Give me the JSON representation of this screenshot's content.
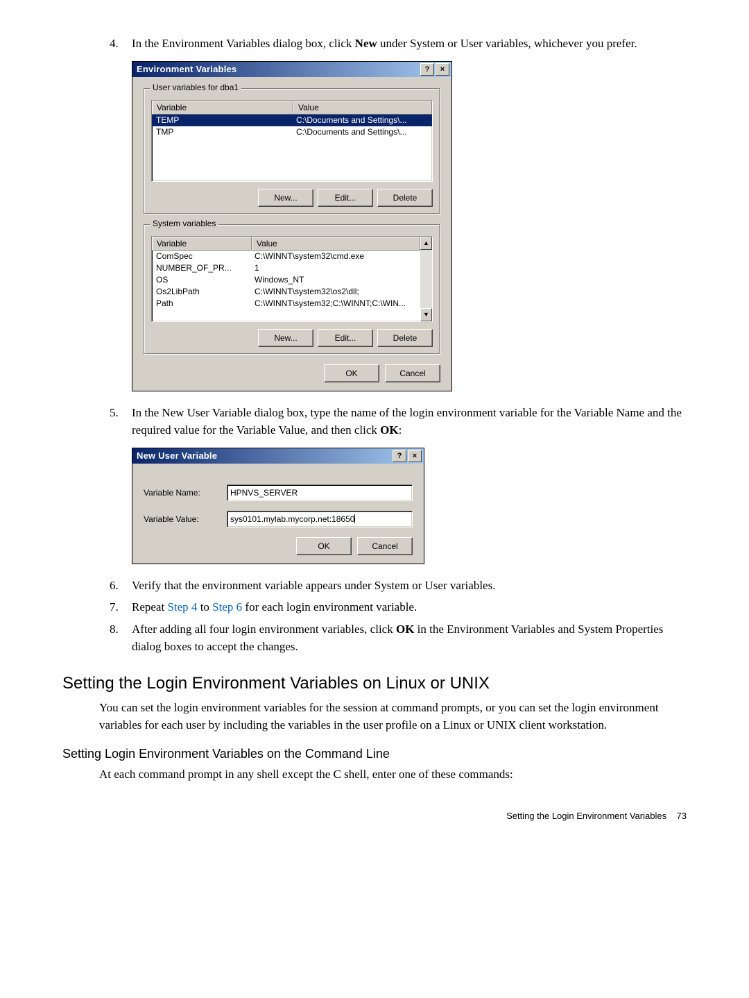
{
  "step4": {
    "num": "4.",
    "text_pre": "In the Environment Variables dialog box, click ",
    "bold": "New",
    "text_post": " under System or User variables, whichever you prefer."
  },
  "env_dialog": {
    "title": "Environment Variables",
    "help_btn": "?",
    "close_btn": "×",
    "user_legend": "User variables for dba1",
    "sys_legend": "System variables",
    "col_variable": "Variable",
    "col_value": "Value",
    "user_rows": [
      {
        "var": "TEMP",
        "val": "C:\\Documents and Settings\\..."
      },
      {
        "var": "TMP",
        "val": "C:\\Documents and Settings\\..."
      }
    ],
    "sys_rows": [
      {
        "var": "ComSpec",
        "val": "C:\\WINNT\\system32\\cmd.exe"
      },
      {
        "var": "NUMBER_OF_PR...",
        "val": "1"
      },
      {
        "var": "OS",
        "val": "Windows_NT"
      },
      {
        "var": "Os2LibPath",
        "val": "C:\\WINNT\\system32\\os2\\dll;"
      },
      {
        "var": "Path",
        "val": "C:\\WINNT\\system32;C:\\WINNT;C:\\WIN..."
      }
    ],
    "btn_new": "New...",
    "btn_edit": "Edit...",
    "btn_delete": "Delete",
    "btn_ok": "OK",
    "btn_cancel": "Cancel",
    "scroll_up": "▲",
    "scroll_down": "▼"
  },
  "step5": {
    "num": "5.",
    "text_pre": "In the New User Variable dialog box, type the name of the login environment variable for the Variable Name and the required value for the Variable Value, and then click ",
    "bold": "OK",
    "text_post": ":"
  },
  "newvar_dialog": {
    "title": "New User Variable",
    "help_btn": "?",
    "close_btn": "×",
    "name_label": "Variable Name:",
    "value_label": "Variable Value:",
    "name_value": "HPNVS_SERVER",
    "value_value": "sys0101.mylab.mycorp.net:18650",
    "btn_ok": "OK",
    "btn_cancel": "Cancel"
  },
  "step6": {
    "num": "6.",
    "text": "Verify that the environment variable appears under System or User variables."
  },
  "step7": {
    "num": "7.",
    "pre": "Repeat ",
    "link1": "Step 4",
    "mid": " to ",
    "link2": "Step 6",
    "post": " for each login environment variable."
  },
  "step8": {
    "num": "8.",
    "pre": "After adding all four login environment variables, click ",
    "bold": "OK",
    "post": " in the Environment Variables and System Properties dialog boxes to accept the changes."
  },
  "heading": "Setting the Login Environment Variables on Linux or UNIX",
  "para1": "You can set the login environment variables for the session at command prompts, or you can set the login environment variables for each user by including the variables in the user profile on a Linux or UNIX client workstation.",
  "subheading": "Setting Login Environment Variables on the Command Line",
  "para2": "At each command prompt in any shell except the C shell, enter one of these commands:",
  "footer": {
    "text": "Setting the Login Environment Variables",
    "page": "73"
  }
}
